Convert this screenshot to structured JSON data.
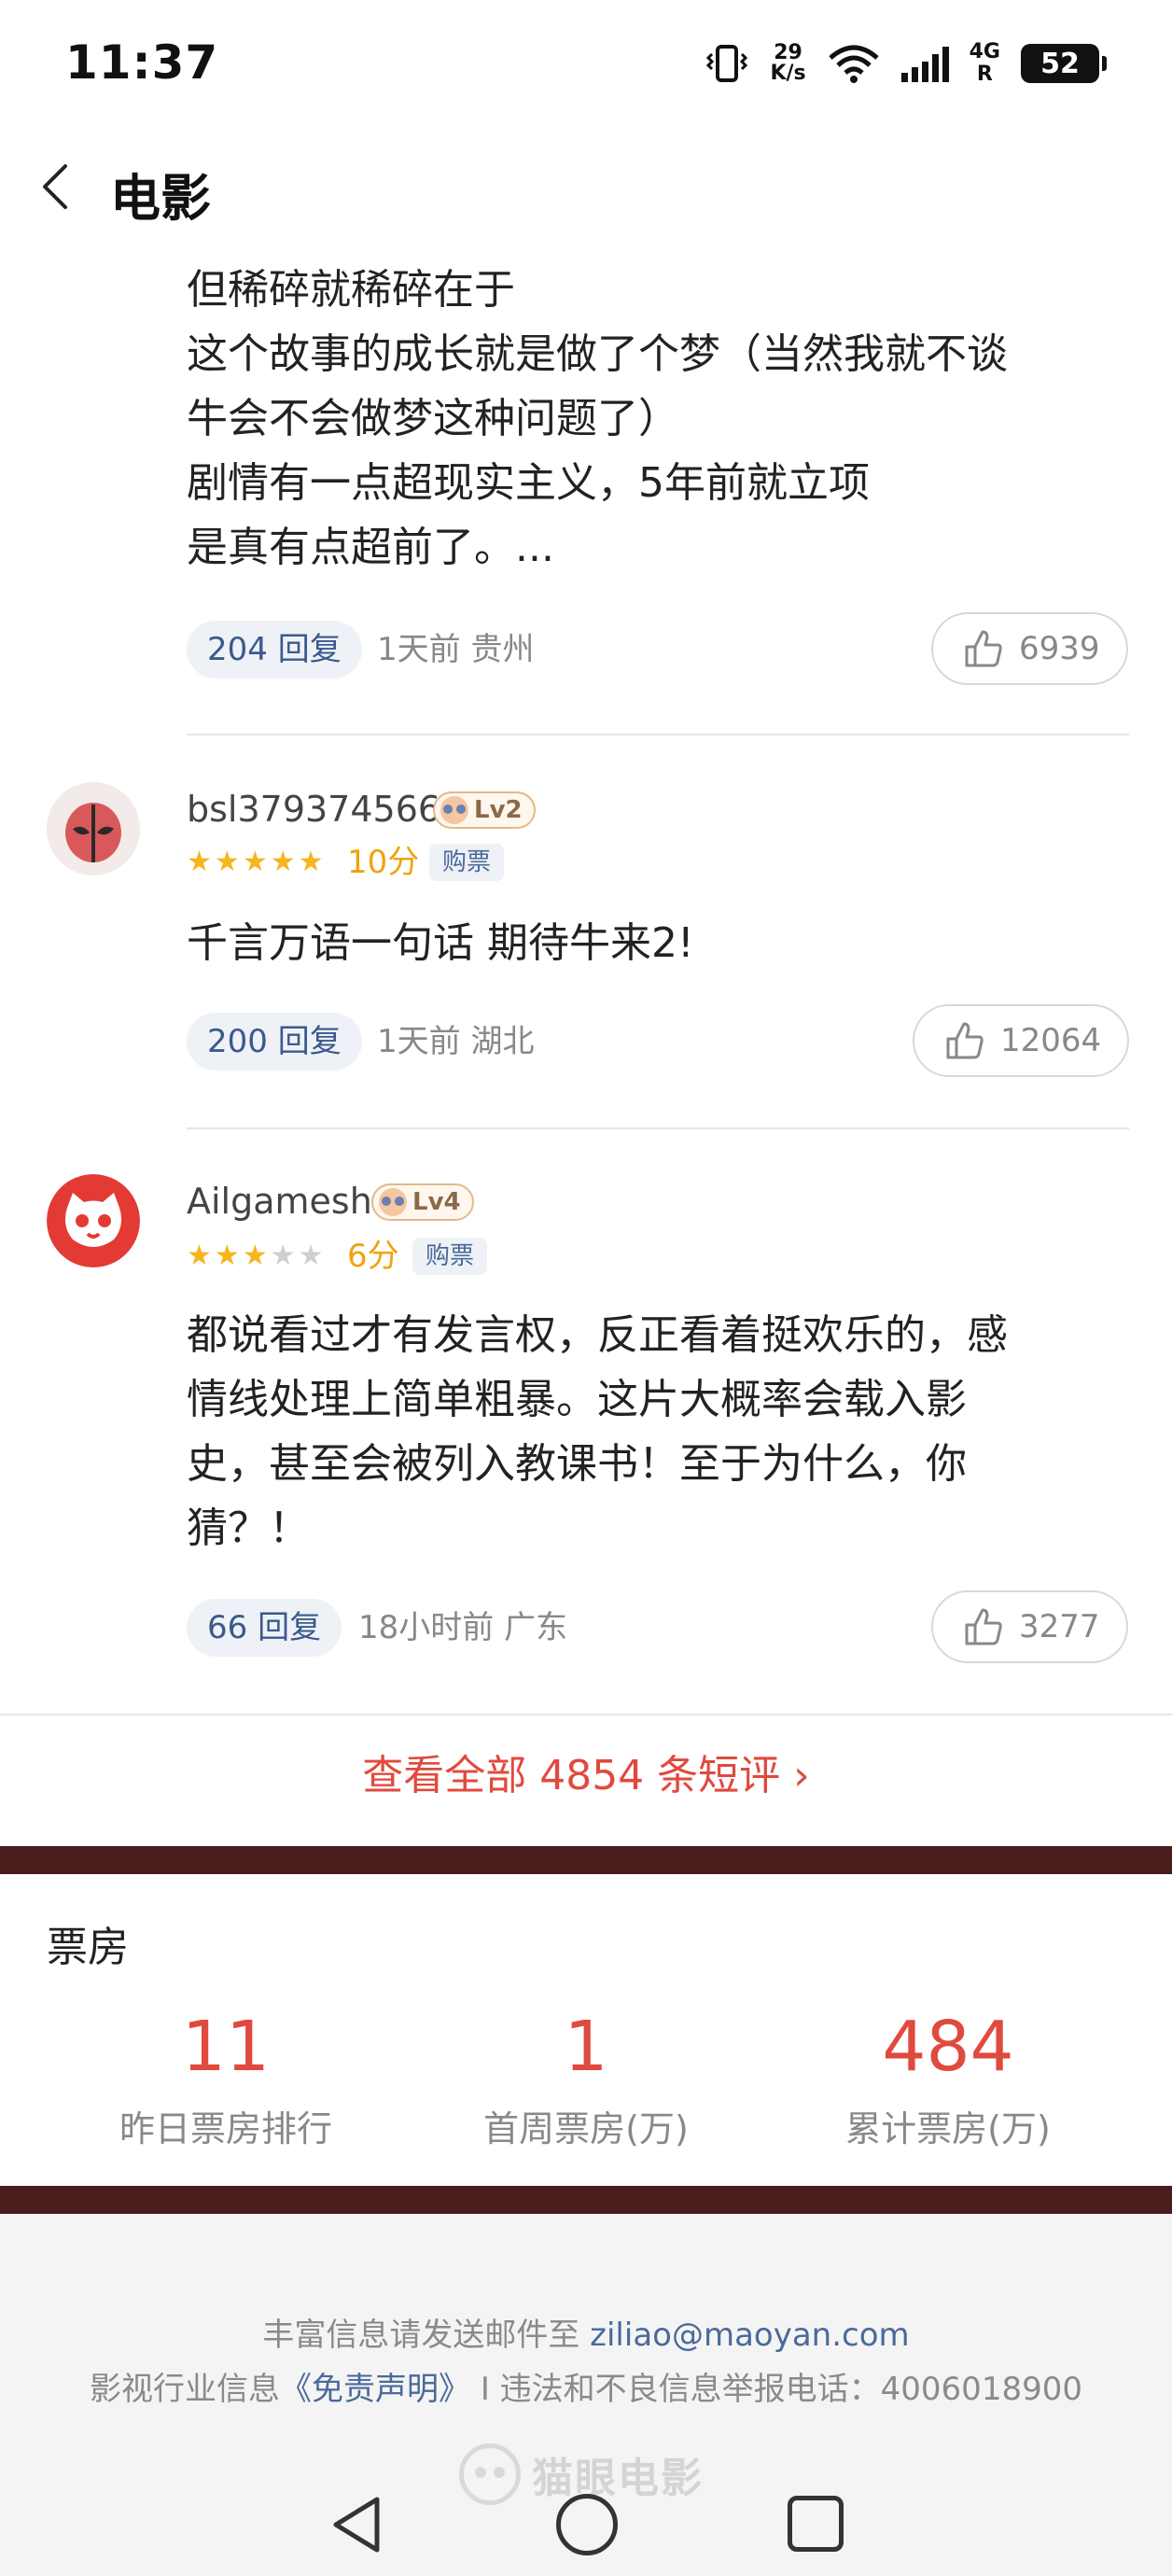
{
  "status": {
    "time": "11:37",
    "net_speed_value": "29",
    "net_speed_unit": "K/s",
    "network": "4G",
    "roaming": "R",
    "battery": "52"
  },
  "header": {
    "title": "电影"
  },
  "reviews": [
    {
      "content_lines": [
        "但稀碎就稀碎在于",
        "这个故事的成长就是做了个梦（当然我就不谈",
        "牛会不会做梦这种问题了）",
        "剧情有一点超现实主义，5年前就立项",
        "是真有点超前了。..."
      ],
      "replies": "204 回复",
      "time_location": "1天前 贵州",
      "likes": "6939"
    },
    {
      "username": "bsl379374566",
      "level": "Lv2",
      "stars": 5,
      "score": "10分",
      "badge": "购票",
      "content": "千言万语一句话  期待牛来2!",
      "replies": "200 回复",
      "time_location": "1天前 湖北",
      "likes": "12064"
    },
    {
      "username": "Ailgamesh",
      "level": "Lv4",
      "stars": 3,
      "score": "6分",
      "badge": "购票",
      "content_lines": [
        "都说看过才有发言权，反正看着挺欢乐的，感",
        "情线处理上简单粗暴。这片大概率会载入影",
        "史，甚至会被列入教课书！至于为什么，你",
        "猜？！"
      ],
      "replies": "66 回复",
      "time_location": "18小时前 广东",
      "likes": "3277"
    }
  ],
  "view_all": "查看全部 4854 条短评 ›",
  "box_office": {
    "title": "票房",
    "items": [
      {
        "value": "11",
        "label": "昨日票房排行"
      },
      {
        "value": "1",
        "label": "首周票房(万)"
      },
      {
        "value": "484",
        "label": "累计票房(万)"
      }
    ]
  },
  "footer": {
    "line1_prefix": "丰富信息请发送邮件至 ",
    "email": "ziliao@maoyan.com",
    "line2_prefix": "影视行业信息",
    "disclaimer": "《免责声明》",
    "line2_suffix": " I 违法和不良信息举报电话：4006018900",
    "logo_text": "猫眼电影"
  },
  "colors": {
    "accent": "#e04a3e",
    "star": "#f6b51c",
    "dark_bar": "#4a1d1d"
  }
}
